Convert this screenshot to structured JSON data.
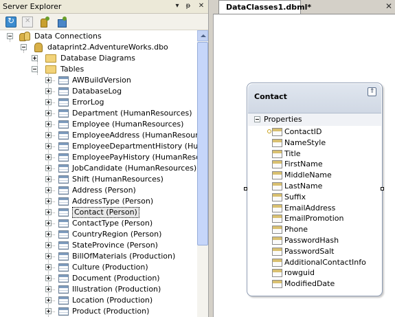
{
  "server_explorer": {
    "title": "Server Explorer",
    "title_buttons": [
      "▾",
      "ᵽ",
      "✕"
    ],
    "tree": {
      "data_connections": "Data Connections",
      "connection": "dataprint2.AdventureWorks.dbo",
      "database_diagrams": "Database Diagrams",
      "tables": "Tables",
      "table_items": [
        "AWBuildVersion",
        "DatabaseLog",
        "ErrorLog",
        "Department (HumanResources)",
        "Employee (HumanResources)",
        "EmployeeAddress (HumanResources)",
        "EmployeeDepartmentHistory (HumanR",
        "EmployeePayHistory (HumanResource",
        "JobCandidate (HumanResources)",
        "Shift (HumanResources)",
        "Address (Person)",
        "AddressType (Person)",
        "Contact (Person)",
        "ContactType (Person)",
        "CountryRegion (Person)",
        "StateProvince (Person)",
        "BillOfMaterials (Production)",
        "Culture (Production)",
        "Document (Production)",
        "Illustration (Production)",
        "Location (Production)",
        "Product (Production)"
      ],
      "selected_item": "Contact (Person)"
    }
  },
  "document": {
    "tab_label": "DataClasses1.dbml*",
    "close_glyph": "✕"
  },
  "entity": {
    "title": "Contact",
    "collapse_glyph": "⇑",
    "section_label": "Properties",
    "properties": [
      "ContactID",
      "NameStyle",
      "Title",
      "FirstName",
      "MiddleName",
      "LastName",
      "Suffix",
      "EmailAddress",
      "EmailPromotion",
      "Phone",
      "PasswordHash",
      "PasswordSalt",
      "AdditionalContactInfo",
      "rowguid",
      "ModifiedDate"
    ],
    "key_property": "ContactID"
  }
}
